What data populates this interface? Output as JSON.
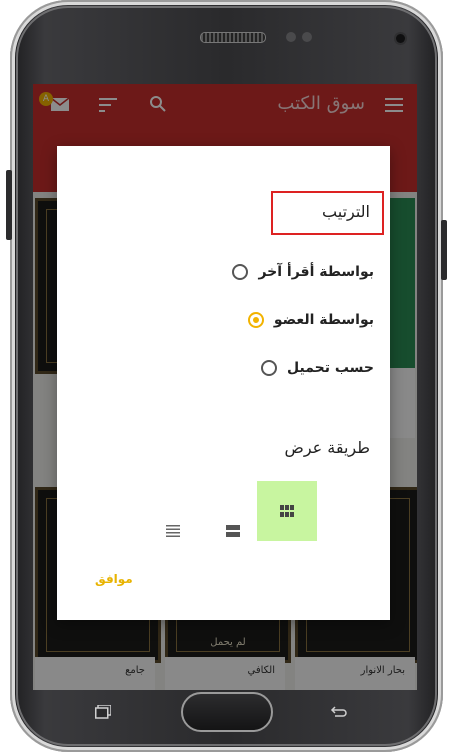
{
  "app_bar": {
    "title": "سوق الكتب",
    "badge": "A"
  },
  "books": [
    {
      "caption": "جامع",
      "label": ""
    },
    {
      "caption": "الكافي",
      "label": "لم يحمل"
    },
    {
      "caption": "بحار الانوار",
      "label": ""
    }
  ],
  "dialog": {
    "sort_title": "الترتيب",
    "sort_options": [
      {
        "label": "بواسطة أقرأ آخر",
        "checked": false
      },
      {
        "label": "بواسطة العضو",
        "checked": true
      },
      {
        "label": "حسب تحميل",
        "checked": false
      }
    ],
    "view_title": "طريقة عرض",
    "view_modes": [
      {
        "icon": "list-icon",
        "selected": false
      },
      {
        "icon": "wide-list-icon",
        "selected": false
      },
      {
        "icon": "grid-icon",
        "selected": true
      }
    ],
    "ok_label": "موافق"
  },
  "colors": {
    "app_bar": "#c62e2d",
    "accent": "#f2b300",
    "selected_view": "#c8f5a0",
    "highlight": "#dd2222"
  }
}
